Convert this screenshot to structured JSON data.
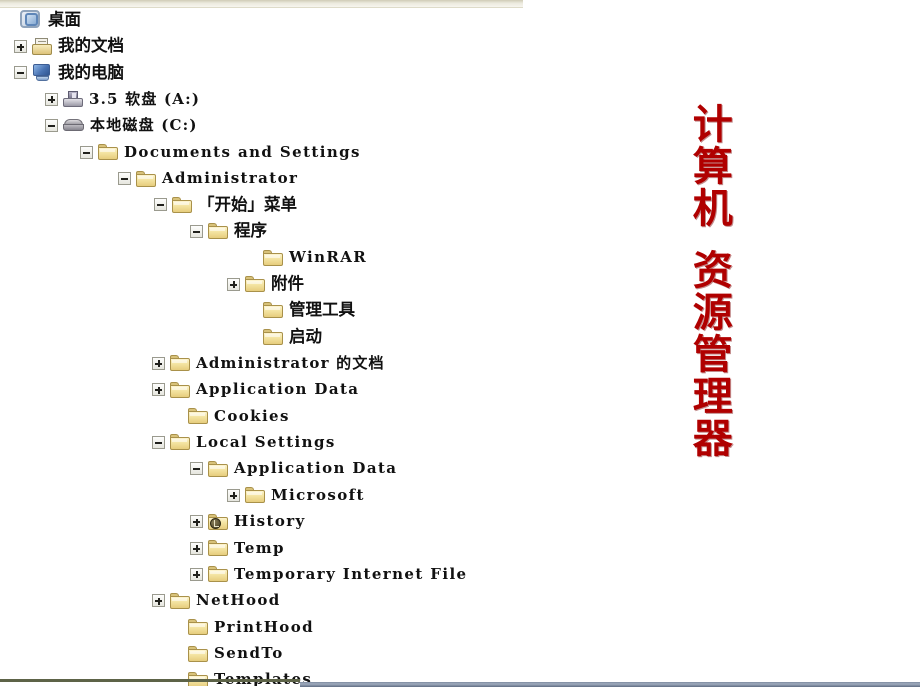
{
  "panel": {
    "name": "windows-explorer-folder-tree",
    "top_strip_color": "#eceade",
    "bottom_edge_left_color": "#5d6347",
    "bottom_edge_right_color": "#8b98ac"
  },
  "title": {
    "color": "#b00000",
    "line1": "计算机",
    "line2": "资源管理器",
    "full": "计算机资源管理器"
  },
  "tree": {
    "rows": [
      {
        "label": "桌面",
        "script": "cjk",
        "indent": 2,
        "toggle": "none",
        "icon": "desktop-icon"
      },
      {
        "label": "我的文档",
        "script": "cjk",
        "indent": 14,
        "toggle": "plus",
        "icon": "my-documents-folder-icon"
      },
      {
        "label": "我的电脑",
        "script": "cjk",
        "indent": 14,
        "toggle": "minus",
        "icon": "my-computer-icon"
      },
      {
        "label": "3.5 软盘 (A:)",
        "script": "mixed",
        "indent": 45,
        "toggle": "plus",
        "icon": "floppy-drive-icon"
      },
      {
        "label": "本地磁盘 (C:)",
        "script": "mixed",
        "indent": 45,
        "toggle": "minus",
        "icon": "hard-disk-icon"
      },
      {
        "label": "Documents and Settings",
        "script": "mono",
        "indent": 80,
        "toggle": "minus",
        "icon": "folder-icon"
      },
      {
        "label": "Administrator",
        "script": "mono",
        "indent": 118,
        "toggle": "minus",
        "icon": "folder-icon"
      },
      {
        "label": "「开始」菜单",
        "script": "cjk",
        "indent": 154,
        "toggle": "minus",
        "icon": "folder-icon"
      },
      {
        "label": "程序",
        "script": "cjk",
        "indent": 190,
        "toggle": "minus",
        "icon": "folder-icon"
      },
      {
        "label": "WinRAR",
        "script": "mono",
        "indent": 245,
        "toggle": "none",
        "icon": "folder-icon"
      },
      {
        "label": "附件",
        "script": "cjk",
        "indent": 227,
        "toggle": "plus",
        "icon": "folder-icon"
      },
      {
        "label": "管理工具",
        "script": "cjk",
        "indent": 245,
        "toggle": "none",
        "icon": "folder-icon"
      },
      {
        "label": "启动",
        "script": "cjk",
        "indent": 245,
        "toggle": "none",
        "icon": "folder-icon"
      },
      {
        "label": "Administrator 的文档",
        "script": "mixed",
        "indent": 152,
        "toggle": "plus",
        "icon": "folder-icon"
      },
      {
        "label": "Application Data",
        "script": "mono",
        "indent": 152,
        "toggle": "plus",
        "icon": "folder-icon"
      },
      {
        "label": "Cookies",
        "script": "mono",
        "indent": 170,
        "toggle": "none",
        "icon": "folder-icon"
      },
      {
        "label": "Local Settings",
        "script": "mono",
        "indent": 152,
        "toggle": "minus",
        "icon": "folder-icon"
      },
      {
        "label": "Application Data",
        "script": "mono",
        "indent": 190,
        "toggle": "minus",
        "icon": "folder-icon"
      },
      {
        "label": "Microsoft",
        "script": "mono",
        "indent": 227,
        "toggle": "plus",
        "icon": "folder-icon"
      },
      {
        "label": "History",
        "script": "mono",
        "indent": 190,
        "toggle": "plus",
        "icon": "history-folder-icon"
      },
      {
        "label": "Temp",
        "script": "mono",
        "indent": 190,
        "toggle": "plus",
        "icon": "folder-icon"
      },
      {
        "label": "Temporary Internet File",
        "script": "mono",
        "indent": 190,
        "toggle": "plus",
        "icon": "folder-icon"
      },
      {
        "label": "NetHood",
        "script": "mono",
        "indent": 152,
        "toggle": "plus",
        "icon": "folder-icon"
      },
      {
        "label": "PrintHood",
        "script": "mono",
        "indent": 170,
        "toggle": "none",
        "icon": "folder-icon"
      },
      {
        "label": "SendTo",
        "script": "mono",
        "indent": 170,
        "toggle": "none",
        "icon": "folder-icon"
      },
      {
        "label": "Templates",
        "script": "mono",
        "indent": 170,
        "toggle": "none",
        "icon": "folder-icon"
      }
    ]
  }
}
